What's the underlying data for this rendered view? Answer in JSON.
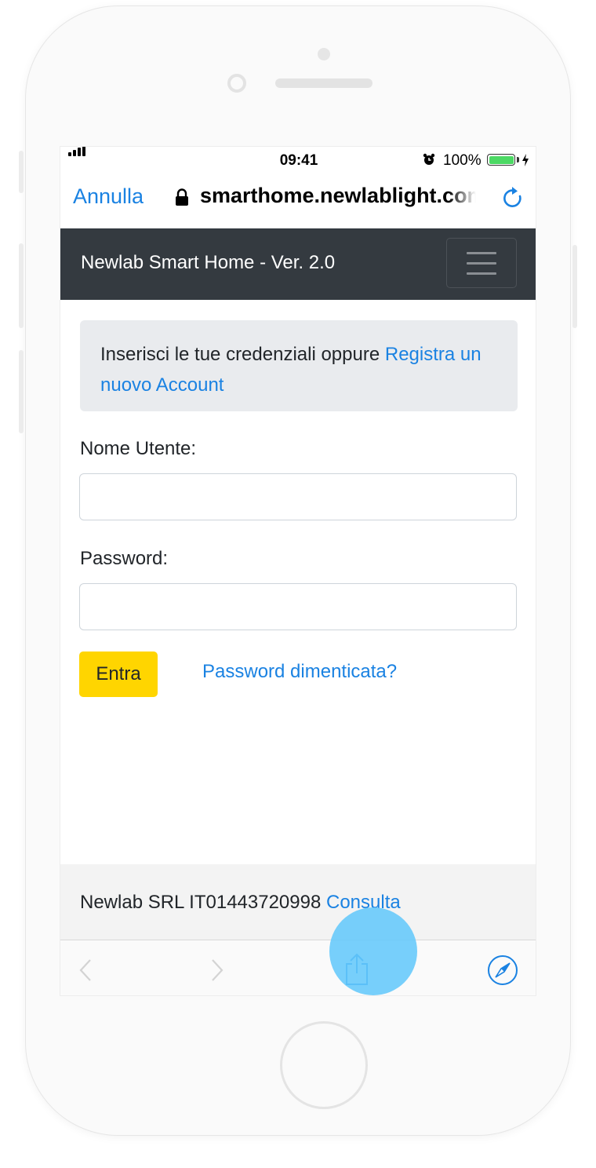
{
  "status_bar": {
    "time": "09:41",
    "battery_percent": "100%",
    "battery_level": 1.0,
    "signal_icon": "signal-bars-icon",
    "alarm_icon": "alarm-clock-icon",
    "charging_icon": "charging-bolt-icon"
  },
  "browser": {
    "cancel_label": "Annulla",
    "url": "smarthome.newlablight.com",
    "lock_icon": "lock-icon",
    "reload_icon": "reload-icon"
  },
  "navbar": {
    "brand": "Newlab Smart Home - Ver. 2.0",
    "menu_icon": "hamburger-menu-icon"
  },
  "alert": {
    "text": "Inserisci le tue credenziali oppure ",
    "link": "Registra un nuovo Account"
  },
  "form": {
    "username_label": "Nome Utente:",
    "username_value": "",
    "password_label": "Password:",
    "password_value": "",
    "submit_label": "Entra",
    "forgot_link": "Password dimenticata?"
  },
  "footer": {
    "text": "Newlab SRL IT01443720998 ",
    "link": "Consulta"
  },
  "toolbar": {
    "back_icon": "chevron-left-icon",
    "forward_icon": "chevron-right-icon",
    "share_icon": "share-icon",
    "compass_icon": "safari-compass-icon"
  },
  "colors": {
    "link": "#1a82e2",
    "navbar": "#343a40",
    "primary_button": "#ffd500",
    "touch_indicator": "#64c8fa"
  }
}
